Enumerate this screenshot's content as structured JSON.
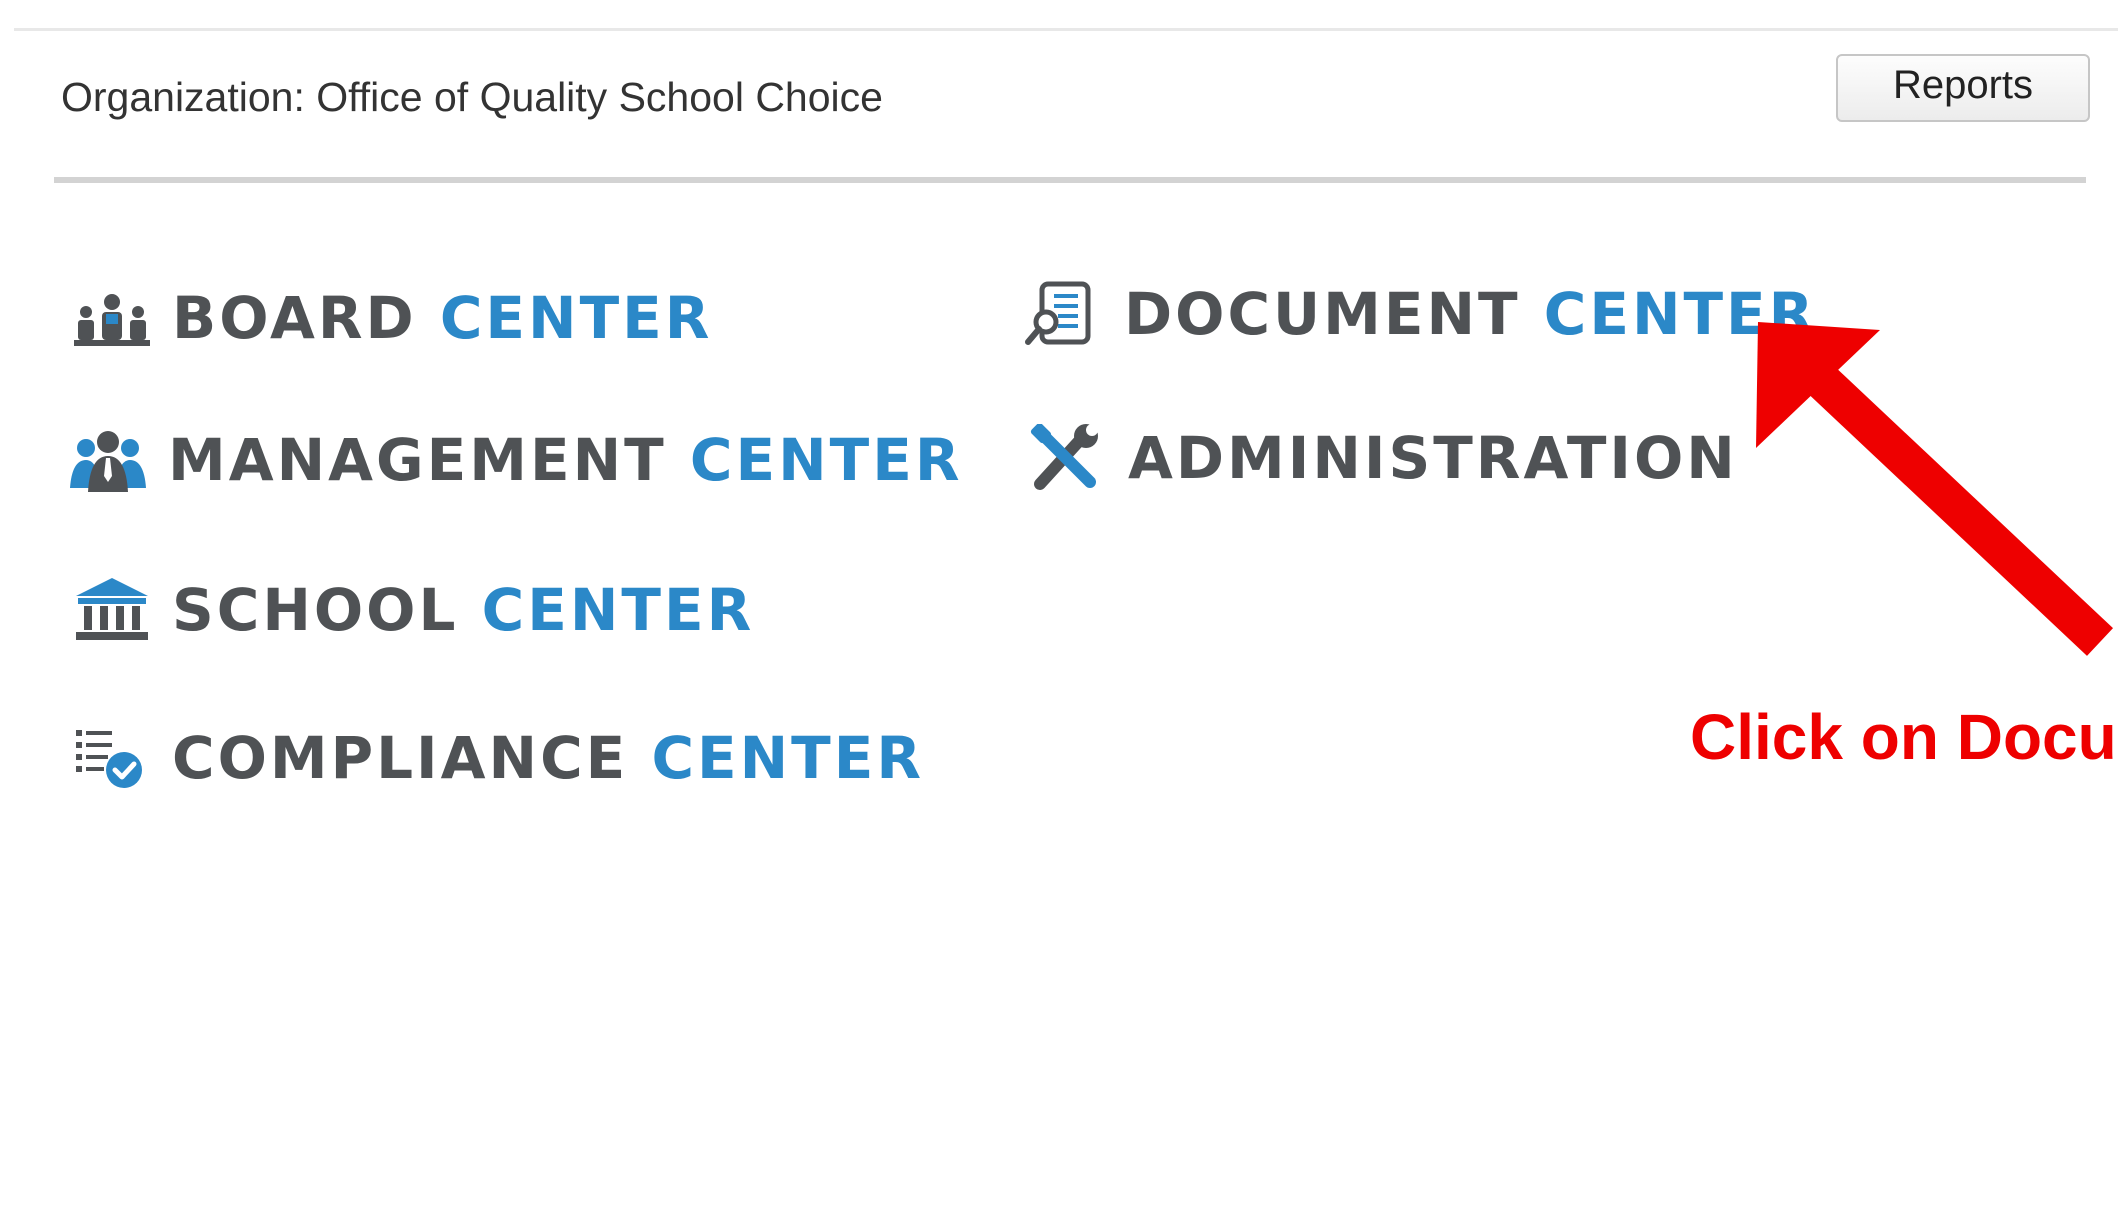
{
  "header": {
    "organization_label": "Organization: Office of Quality School Choice",
    "reports_button": "Reports"
  },
  "nav": {
    "board": {
      "word1": "BOARD",
      "word2": "CENTER",
      "icon": "board-people-icon"
    },
    "management": {
      "word1": "MANAGEMENT",
      "word2": "CENTER",
      "icon": "management-team-icon"
    },
    "school": {
      "word1": "SCHOOL",
      "word2": "CENTER",
      "icon": "school-building-icon"
    },
    "compliance": {
      "word1": "COMPLIANCE",
      "word2": "CENTER",
      "icon": "compliance-checklist-icon"
    },
    "document": {
      "word1": "DOCUMENT",
      "word2": "CENTER",
      "icon": "document-search-icon"
    },
    "administration": {
      "word1": "ADMINISTRATION",
      "icon": "tools-icon"
    }
  },
  "annotation": {
    "text": "Click on Document Center",
    "color": "#ee0000"
  },
  "colors": {
    "gray_text": "#4f5255",
    "blue_text": "#2b88c8"
  }
}
